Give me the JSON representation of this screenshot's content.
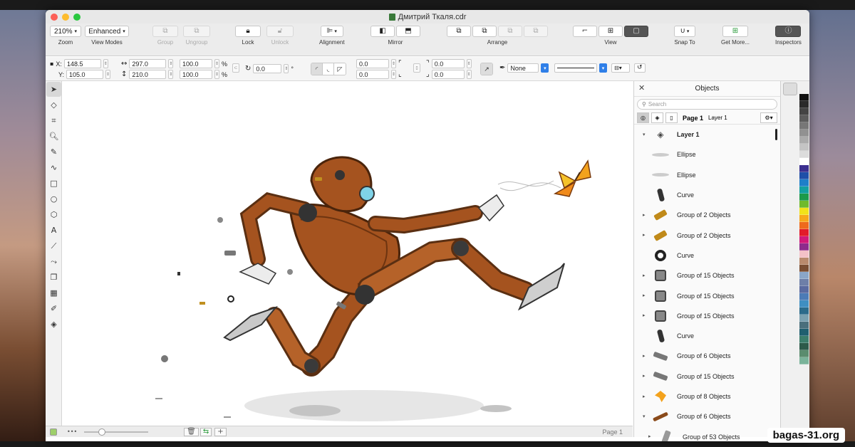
{
  "window": {
    "title": "Дмитрий Ткаля.cdr"
  },
  "toolbar": {
    "zoom": {
      "value": "210%",
      "label": "Zoom"
    },
    "view_modes": {
      "value": "Enhanced",
      "label": "View Modes"
    },
    "group_label": "Group",
    "ungroup_label": "Ungroup",
    "lock_label": "Lock",
    "unlock_label": "Unlock",
    "alignment_label": "Alignment",
    "mirror_label": "Mirror",
    "arrange_label": "Arrange",
    "view_label": "View",
    "snap_label": "Snap To",
    "getmore_label": "Get More...",
    "inspectors_label": "Inspectors"
  },
  "propbar": {
    "x_label": "X:",
    "x": "148.5",
    "y_label": "Y:",
    "y": "105.0",
    "width": "297.0",
    "height": "210.0",
    "scale_w": "100.0",
    "scale_h": "100.0",
    "percent": "%",
    "angle": "0.0",
    "degree": "°",
    "corner1": "0.0",
    "corner2": "0.0",
    "corner3": "0.0",
    "corner4": "0.0",
    "outline": "None"
  },
  "objects_panel": {
    "title": "Objects",
    "search_placeholder": "Search",
    "page": "Page 1",
    "layer_in_bar": "Layer 1",
    "items": [
      {
        "label": "Layer 1",
        "caret": "▾",
        "icon": "layers-icon"
      },
      {
        "label": "Ellipse",
        "caret": "",
        "icon": "ellipse-thumb"
      },
      {
        "label": "Ellipse",
        "caret": "",
        "icon": "ellipse-thumb"
      },
      {
        "label": "Curve",
        "caret": "",
        "icon": "bolt-thumb"
      },
      {
        "label": "Group of 2 Objects",
        "caret": "▸",
        "icon": "screw-thumb"
      },
      {
        "label": "Group of 2 Objects",
        "caret": "▸",
        "icon": "screw-thumb"
      },
      {
        "label": "Curve",
        "caret": "",
        "icon": "ring-thumb"
      },
      {
        "label": "Group of 15 Objects",
        "caret": "▸",
        "icon": "nut-thumb"
      },
      {
        "label": "Group of 15 Objects",
        "caret": "▸",
        "icon": "nut-thumb"
      },
      {
        "label": "Group of 15 Objects",
        "caret": "▸",
        "icon": "nut-thumb"
      },
      {
        "label": "Curve",
        "caret": "",
        "icon": "bolt-thumb"
      },
      {
        "label": "Group of 6 Objects",
        "caret": "▸",
        "icon": "bolt-side-thumb"
      },
      {
        "label": "Group of 15 Objects",
        "caret": "▸",
        "icon": "bolt-side-thumb"
      },
      {
        "label": "Group of 8 Objects",
        "caret": "▸",
        "icon": "butterfly-thumb"
      },
      {
        "label": "Group of 6 Objects",
        "caret": "▾",
        "icon": "arm-thumb"
      },
      {
        "label": "Group of 53 Objects",
        "caret": "▸",
        "icon": "leg-thumb"
      }
    ]
  },
  "palette": {
    "colors": [
      "#111111",
      "#2a2a2a",
      "#444444",
      "#5c5c5c",
      "#777777",
      "#919191",
      "#ababab",
      "#c4c4c4",
      "#dcdcdc",
      "#ffffff",
      "#3b2f8f",
      "#1f4fa8",
      "#1e7fc9",
      "#13a0a0",
      "#1c9a4a",
      "#6fba2c",
      "#f2e21a",
      "#f7a81b",
      "#ee6a1c",
      "#e21b2a",
      "#d1197a",
      "#8d2b8c",
      "#f4c2c8",
      "#b98a6d",
      "#7a4e33",
      "#8aa6c8",
      "#6e7fa8",
      "#5a6aa0",
      "#4c7bb6",
      "#3f8fc1",
      "#2b6b8a",
      "#7aa1b0",
      "#4a6f7c",
      "#1f5f6f",
      "#3b7d6b",
      "#2d5a4a",
      "#5a8c6e",
      "#7ab39a"
    ]
  },
  "status": {
    "page_tab": "Page 1"
  },
  "watermark": "bagas-31.org"
}
